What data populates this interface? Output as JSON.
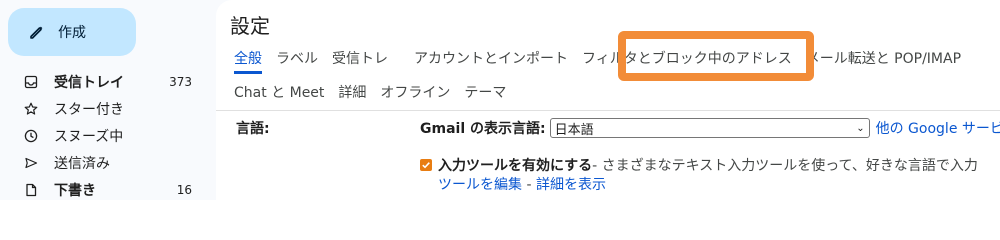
{
  "sidebar": {
    "compose_label": "作成",
    "items": [
      {
        "label": "受信トレイ",
        "count": "373"
      },
      {
        "label": "スター付き",
        "count": ""
      },
      {
        "label": "スヌーズ中",
        "count": ""
      },
      {
        "label": "送信済み",
        "count": ""
      },
      {
        "label": "下書き",
        "count": "16"
      }
    ]
  },
  "main": {
    "title": "設定",
    "tabs_row1": [
      "全般",
      "ラベル",
      "受信トレ",
      "アカウントとインポート",
      "フィルタとブロック中のアドレス",
      "メール転送と POP/IMAP"
    ],
    "tabs_row2": [
      "Chat と Meet",
      "詳細",
      "オフライン",
      "テーマ"
    ],
    "setting_label": "言語:",
    "gmail_lang_label": "Gmail の表示言語:",
    "gmail_lang_value": "日本語",
    "other_lang_link": "他の Google サービ",
    "input_tools_label": "入力ツールを有効にする",
    "input_tools_desc": " - さまざまなテキスト入力ツールを使って、好きな言語で入力",
    "edit_tools_link": "ツールを編集",
    "separator": " - ",
    "details_link": "詳細を表示"
  },
  "colors": {
    "accent": "#0b57d0",
    "compose_bg": "#c2e7ff",
    "highlight": "#f28c38",
    "checkbox": "#e87d12"
  },
  "icons": {
    "compose": "pencil-icon",
    "inbox": "inbox-icon",
    "starred": "star-icon",
    "snoozed": "clock-icon",
    "sent": "send-icon",
    "drafts": "draft-icon"
  }
}
